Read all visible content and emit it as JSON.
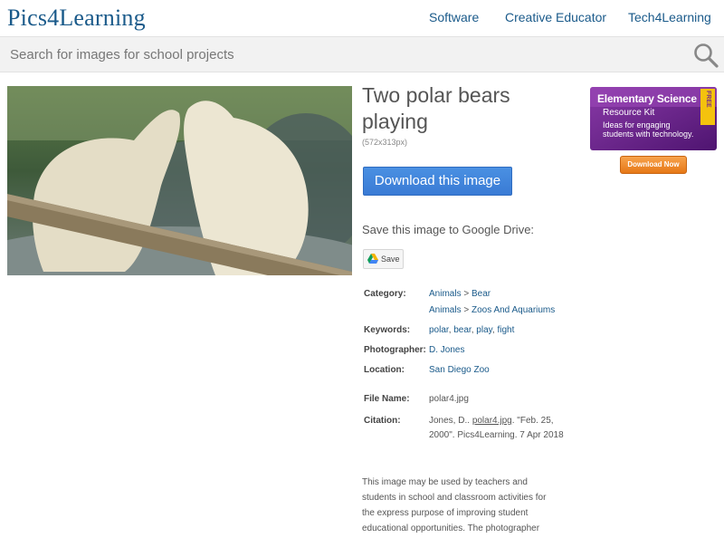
{
  "header": {
    "logo": "Pics4Learning",
    "nav": [
      "Software",
      "Creative Educator",
      "Tech4Learning"
    ]
  },
  "search": {
    "placeholder": "Search for images for school projects",
    "icon": "search-icon"
  },
  "image": {
    "title": "Two polar bears playing",
    "dimensions": "(572x313px)",
    "download_label": "Download this image",
    "gdrive_label": "Save this image to Google Drive:",
    "save_label": "Save"
  },
  "meta": {
    "category_label": "Category:",
    "categories": [
      {
        "parent": "Animals",
        "sep": ">",
        "child": "Bear"
      },
      {
        "parent": "Animals",
        "sep": ">",
        "child": "Zoos And Aquariums"
      }
    ],
    "keywords_label": "Keywords:",
    "keywords": [
      "polar",
      "bear",
      "play",
      "fight"
    ],
    "keyword_sep": ",",
    "photographer_label": "Photographer:",
    "photographer": "D. Jones",
    "location_label": "Location:",
    "location": "San Diego Zoo",
    "filename_label": "File Name:",
    "filename": "polar4.jpg",
    "citation_label": "Citation:",
    "citation_prefix": "Jones, D..",
    "citation_file": "polar4.jpg",
    "citation_suffix": ". \"Feb. 25, 2000\". Pics4Learning. 7 Apr 2018"
  },
  "usage_text": "This image may be used by teachers and students in school and classroom activities for the express purpose of improving student educational opportunities. The photographer",
  "ad": {
    "title": "Elementary Science",
    "subtitle": "Resource Kit",
    "description": "Ideas for engaging students with technology.",
    "badge": "FREE",
    "button": "Download Now"
  }
}
